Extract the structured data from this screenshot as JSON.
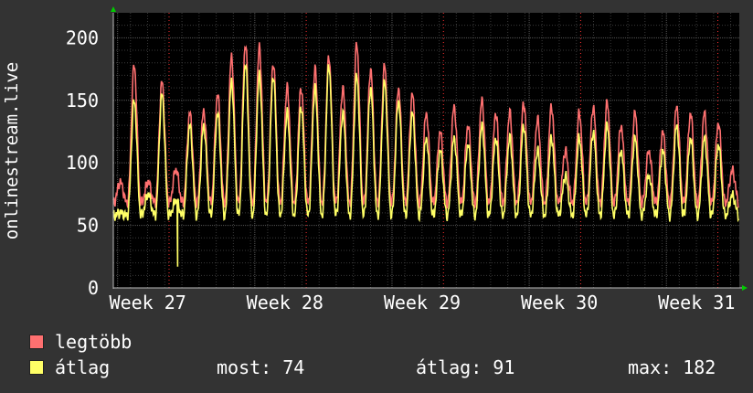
{
  "chart_data": {
    "type": "line",
    "ylabel": "onlinestream.live",
    "ylim": [
      0,
      220
    ],
    "yticks": [
      0,
      50,
      100,
      150,
      200
    ],
    "xticks": [
      "Week 27",
      "Week 28",
      "Week 29",
      "Week 30",
      "Week 31"
    ],
    "grid": true,
    "legend_placement": "bottom-left",
    "series": [
      {
        "name": "legtöbb",
        "color": "#ff7070",
        "daily_peaks": [
          85,
          178,
          85,
          165,
          95,
          140,
          142,
          155,
          185,
          195,
          192,
          180,
          160,
          160,
          175,
          185,
          160,
          195,
          175,
          178,
          160,
          155,
          140,
          125,
          145,
          130,
          150,
          140,
          140,
          148,
          135,
          145,
          110,
          140,
          145,
          148,
          130,
          140,
          110,
          125,
          145,
          140,
          140,
          132,
          94
        ]
      },
      {
        "name": "átlag",
        "color": "#ffff66",
        "daily_peaks": [
          60,
          150,
          75,
          155,
          70,
          130,
          130,
          140,
          165,
          180,
          170,
          170,
          140,
          145,
          160,
          178,
          140,
          170,
          160,
          165,
          150,
          140,
          120,
          110,
          120,
          115,
          130,
          120,
          120,
          130,
          110,
          120,
          90,
          120,
          125,
          130,
          110,
          120,
          90,
          110,
          130,
          120,
          120,
          115,
          74
        ]
      }
    ],
    "x_range_days": 36.5,
    "dip": {
      "series": "átlag",
      "day": 3.75,
      "value": 17
    },
    "background": "#333333",
    "plot_background": "#000000",
    "grid_color": "#555555",
    "minor_grid_color": "#3a3a3a",
    "week_line_color": "#ff3030"
  },
  "legend": {
    "max_label": "legtöbb",
    "avg_label": "átlag"
  },
  "stats": {
    "now": "most: 74",
    "avg": "átlag: 91",
    "max": "max: 182"
  }
}
